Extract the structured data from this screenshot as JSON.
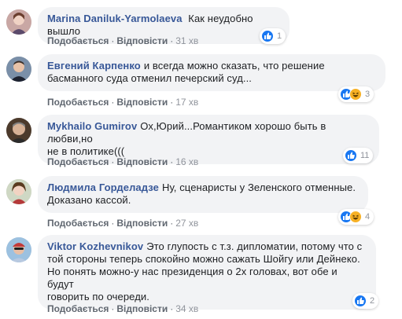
{
  "actions": {
    "like_label": "Подобається",
    "reply_label": "Відповісти",
    "separator": "·"
  },
  "comments": [
    {
      "author": "Marina Daniluk-Yarmolaeva",
      "text_lines": [
        "Как неудобно вышло"
      ],
      "time": "31 хв",
      "reactions": [
        "like"
      ],
      "reaction_count": "1"
    },
    {
      "author": "Евгений Карпенко",
      "text_lines": [
        "и всегда можно сказать, что решение",
        "басманного суда отменил печерский суд..."
      ],
      "time": "17 хв",
      "reactions": [
        "like",
        "haha"
      ],
      "reaction_count": "3"
    },
    {
      "author": "Mykhailo Gumirov",
      "text_lines": [
        "Ох,Юрий...Романтиком хорошо быть в любви,но",
        "не в политике((("
      ],
      "time": "16 хв",
      "reactions": [
        "like"
      ],
      "reaction_count": "11"
    },
    {
      "author": "Людмила Горделадзе",
      "text_lines": [
        "Ну, сценаристы у Зеленского отменные.",
        "Доказано кассой."
      ],
      "time": "27 хв",
      "reactions": [
        "like",
        "haha"
      ],
      "reaction_count": "4"
    },
    {
      "author": "Viktor Kozhevnikov",
      "text_lines": [
        "Это глупость с т.з. дипломатии, потому что с",
        "той стороны теперь спокойно можно сажать Шойгу или Дейнеко.",
        "Но понять можно-у нас президенция о 2х головах, вот обе и будут",
        "говорить по очереди."
      ],
      "time": "34 хв",
      "reactions": [
        "like"
      ],
      "reaction_count": "2"
    }
  ],
  "colors": {
    "author": "#385898",
    "bubble": "#f2f3f5",
    "like": "#1877f2",
    "haha": "#f7b125"
  }
}
